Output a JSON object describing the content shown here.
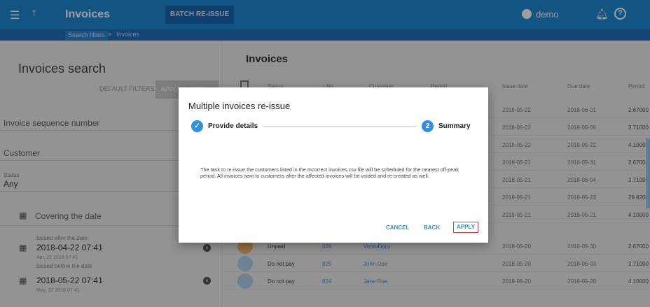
{
  "appbar": {
    "menu_icon": "menu-icon",
    "up_icon": "arrow-up-icon",
    "title": "Invoices",
    "batch_button": "BATCH RE-ISSUE",
    "user_name": "demo",
    "bell_icon": "bell-icon",
    "help_icon": "help-icon"
  },
  "breadcrumb": {
    "parent": "Search filters",
    "current": "Invoices"
  },
  "search": {
    "title": "Invoices search",
    "default_filters": "DEFAULT FILTERS",
    "apply_filters": "APPLY FILTERS",
    "invoice_seq_label": "Invoice sequence number",
    "customer_label": "Customer",
    "status_label": "Status",
    "status_value": "Any",
    "covering_date_label": "Covering the date",
    "issued_after_label": "Issued after the date",
    "issued_after_value": "2018-04-22 07:41",
    "issued_after_hint": "Apr, 22 2018 07:41",
    "issued_before_label": "Issued before the date",
    "issued_before_value": "2018-05-22 07:41",
    "issued_before_hint": "May, 22 2018 07:41"
  },
  "list": {
    "title": "Invoices",
    "columns": [
      "Status",
      "↑ No",
      "Customer",
      "Period",
      "Issue date",
      "Due date",
      "Period"
    ],
    "rows": [
      {
        "status": "",
        "no": "",
        "customer": "",
        "issue": "2018-05-22",
        "due": "2018-06-01",
        "amount": "2.67000"
      },
      {
        "status": "",
        "no": "",
        "customer": "",
        "issue": "2018-05-22",
        "due": "2018-06-05",
        "amount": "3.71000"
      },
      {
        "status": "",
        "no": "",
        "customer": "",
        "issue": "2018-05-22",
        "due": "2018-05-22",
        "amount": "4.10000"
      },
      {
        "status": "",
        "no": "",
        "customer": "",
        "issue": "2018-05-21",
        "due": "2018-05-31",
        "amount": "2.67000"
      },
      {
        "status": "",
        "no": "",
        "customer": "",
        "issue": "2018-05-21",
        "due": "2018-06-04",
        "amount": "3.71000"
      },
      {
        "status": "",
        "no": "",
        "customer": "",
        "issue": "2018-05-21",
        "due": "2018-05-23",
        "amount": "29.8200"
      },
      {
        "status": "",
        "no": "",
        "customer": "",
        "issue": "2018-05-21",
        "due": "2018-05-21",
        "amount": "4.10000"
      },
      {
        "status": "Unpaid",
        "no": "826",
        "customer": "VeritoDaily",
        "issue": "2018-05-20",
        "due": "2018-05-30",
        "amount": "2.67000"
      },
      {
        "status": "Do not pay",
        "no": "825",
        "customer": "John Doe",
        "issue": "2018-05-20",
        "due": "2018-06-03",
        "amount": "3.71000"
      },
      {
        "status": "Do not pay",
        "no": "824",
        "customer": "Jane Roe",
        "issue": "2018-05-20",
        "due": "2018-05-20",
        "amount": "4.10000"
      }
    ]
  },
  "modal": {
    "title": "Multiple invoices re-issue",
    "step1_icon": "check-icon",
    "step1_label": "Provide details",
    "step2_number": "2",
    "step2_label": "Summary",
    "body": "The task to re-issue the customers listed in the Incorrect invoices.csv file will be scheduled for the nearest off-peak period. All invoices sent to customers after the affected invoices will be voided and re-created as well.",
    "cancel": "CANCEL",
    "back": "BACK",
    "apply": "APPLY"
  },
  "colors": {
    "appbar": "#1e88d6",
    "accent": "#2f8fe3",
    "highlight_border": "#ee3333"
  }
}
